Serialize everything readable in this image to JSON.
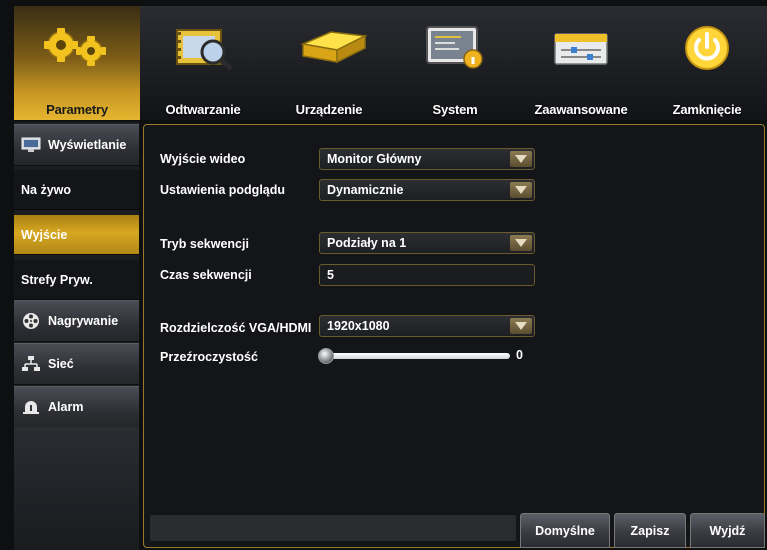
{
  "top_tabs": [
    {
      "label": "Parametry",
      "icon": "gears-icon",
      "active": true
    },
    {
      "label": "Odtwarzanie",
      "icon": "film-magnifier-icon",
      "active": false
    },
    {
      "label": "Urządzenie",
      "icon": "hard-drive-icon",
      "active": false
    },
    {
      "label": "System",
      "icon": "monitor-info-icon",
      "active": false
    },
    {
      "label": "Zaawansowane",
      "icon": "sliders-panel-icon",
      "active": false
    },
    {
      "label": "Zamknięcie",
      "icon": "power-icon",
      "active": false
    }
  ],
  "sidebar": {
    "items": [
      {
        "label": "Wyświetlanie",
        "type": "header",
        "icon": "monitor-icon"
      },
      {
        "label": "Na żywo",
        "type": "sub",
        "active": false
      },
      {
        "label": "Wyjście",
        "type": "sub",
        "active": true
      },
      {
        "label": "Strefy Pryw.",
        "type": "sub",
        "active": false
      },
      {
        "label": "Nagrywanie",
        "type": "header",
        "icon": "film-reel-icon"
      },
      {
        "label": "Sieć",
        "type": "header",
        "icon": "network-icon"
      },
      {
        "label": "Alarm",
        "type": "header",
        "icon": "alarm-bell-icon"
      }
    ]
  },
  "form": {
    "video_output": {
      "label": "Wyjście wideo",
      "value": "Monitor Główny"
    },
    "preview_settings": {
      "label": "Ustawienia podglądu",
      "value": "Dynamicznie"
    },
    "sequence_mode": {
      "label": "Tryb sekwencji",
      "value": "Podziały na 1"
    },
    "sequence_time": {
      "label": "Czas sekwencji",
      "value": "5"
    },
    "resolution": {
      "label": "Rozdzielczość VGA/HDMI",
      "value": "1920x1080"
    },
    "transparency": {
      "label": "Przeźroczystość",
      "value": "0",
      "level": 0
    }
  },
  "buttons": {
    "default_label": "Domyślne",
    "save_label": "Zapisz",
    "exit_label": "Wyjdź"
  },
  "colors": {
    "accent": "#d7a722",
    "panel_border": "#9a7a2a",
    "background": "#141518"
  }
}
